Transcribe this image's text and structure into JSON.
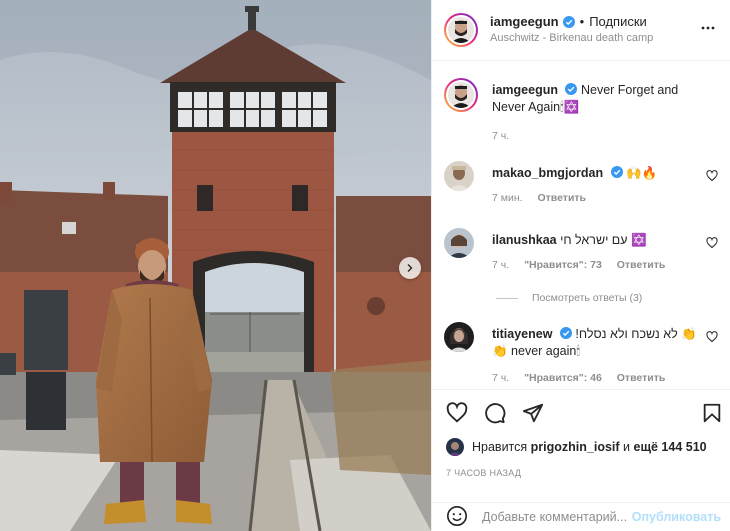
{
  "post": {
    "author": "iamgeegun",
    "follow_label": "Подписки",
    "separator": "•",
    "location": "Auschwitz - Birkenau death camp"
  },
  "caption": {
    "username": "iamgeegun",
    "text": "Never Forget and Never Again🕯✡️",
    "time": "7 ч."
  },
  "comments": [
    {
      "username": "makao_bmgjordan",
      "text": "🙌🔥",
      "time": "7 мин.",
      "reply_label": "Ответить"
    },
    {
      "username": "ilanushkaa",
      "text": "עם ישראל חי ✡️",
      "time": "7 ч.",
      "likes_label": "\"Нравится\": 73",
      "reply_label": "Ответить"
    },
    {
      "username": "titiayenew",
      "text": "!לא נשכח ולא נסלח 👏👏 never again🕯",
      "time": "7 ч.",
      "likes_label": "\"Нравится\": 46",
      "reply_label": "Ответить"
    }
  ],
  "view_replies": "Посмотреть ответы (3)",
  "likes": {
    "liked_by": "prigozhin_iosif",
    "connector": "и",
    "others": "ещё 144 510",
    "prefix": "Нравится"
  },
  "time_ago": "7 ЧАСОВ НАЗАД",
  "add_comment": {
    "placeholder": "Добавьте комментарий...",
    "publish_label": "Опубликовать"
  },
  "icons": {
    "more": "more-horizontal-icon",
    "heart": "heart-icon",
    "comment": "comment-icon",
    "share": "share-icon",
    "save": "bookmark-icon",
    "emoji": "emoji-icon",
    "next": "chevron-right-icon",
    "verified": "verified-badge-icon"
  },
  "colors": {
    "verified": "#3897f0",
    "publish": "#b2dffc",
    "secondary_text": "#8e8e8e"
  }
}
